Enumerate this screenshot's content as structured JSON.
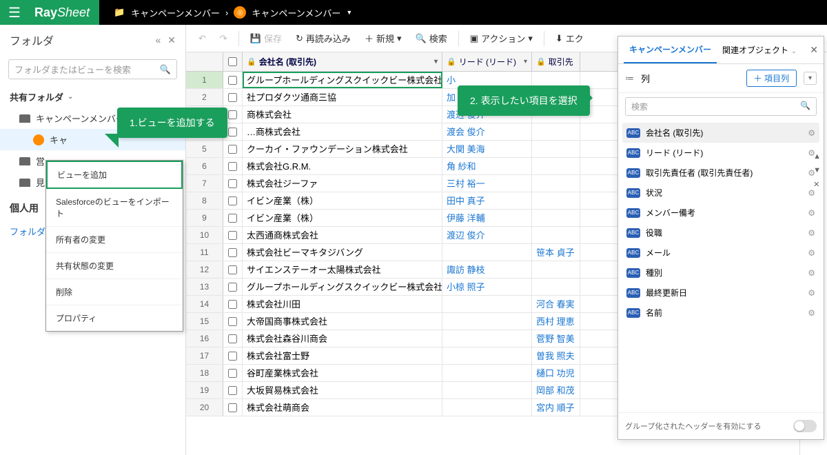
{
  "header": {
    "logo_ray": "Ray",
    "logo_sheet": "Sheet",
    "breadcrumb_parent": "キャンペーンメンバー",
    "breadcrumb_sep": "›",
    "breadcrumb_child": "キャンペーンメンバー",
    "breadcrumb_dd": "▼"
  },
  "sidebar": {
    "title": "フォルダ",
    "collapse": "«",
    "close": "✕",
    "search_placeholder": "フォルダまたはビューを検索",
    "shared_label": "共有フォルダ",
    "tree": {
      "campaign": "キャンペーンメンバー",
      "campaign_sub": "キャ",
      "sales": "営",
      "quote": "見"
    },
    "personal_label": "個人用",
    "folder_link": "フォルダを"
  },
  "ctx": {
    "add_view": "ビューを追加",
    "import_sf": "Salesforceのビューをインポート",
    "change_owner": "所有者の変更",
    "change_share": "共有状態の変更",
    "delete": "削除",
    "property": "プロパティ"
  },
  "callout": {
    "c1": "1.ビューを追加する",
    "c2": "2. 表示したい項目を選択"
  },
  "toolbar": {
    "undo": "↶",
    "redo": "↷",
    "save": "保存",
    "reload": "再読み込み",
    "new": "新規",
    "search": "検索",
    "action": "アクション",
    "export": "エク"
  },
  "grid": {
    "headers": {
      "company": "会社名 (取引先)",
      "lead": "リード (リード)",
      "owner": "取引先"
    },
    "rows": [
      {
        "n": 1,
        "company": "グループホールディングスクイックビー株式会社",
        "lead": "小",
        "owner": ""
      },
      {
        "n": 2,
        "company": "社プロダクツ通商三協",
        "lead": "加",
        "owner": ""
      },
      {
        "n": 3,
        "company": "商株式会社",
        "lead": "渡辺 俊介",
        "owner": ""
      },
      {
        "n": 4,
        "company": "…商株式会社",
        "lead": "渡会 俊介",
        "owner": ""
      },
      {
        "n": 5,
        "company": "クーカイ・ファウンデーション株式会社",
        "lead": "大関 美海",
        "owner": ""
      },
      {
        "n": 6,
        "company": "株式会社G.R.M.",
        "lead": "角 紗和",
        "owner": ""
      },
      {
        "n": 7,
        "company": "株式会社ジーファ",
        "lead": "三村 裕一",
        "owner": ""
      },
      {
        "n": 8,
        "company": "イビン産業（株）",
        "lead": "田中 真子",
        "owner": ""
      },
      {
        "n": 9,
        "company": "イビン産業（株）",
        "lead": "伊藤 洋輔",
        "owner": ""
      },
      {
        "n": 10,
        "company": "太西通商株式会社",
        "lead": "渡辺 俊介",
        "owner": ""
      },
      {
        "n": 11,
        "company": "株式会社ビーマキタジバング",
        "lead": "",
        "owner": "笹本 貞子"
      },
      {
        "n": 12,
        "company": "サイエンステーオー太陽株式会社",
        "lead": "諏訪 静枝",
        "owner": ""
      },
      {
        "n": 13,
        "company": "グループホールディングスクイックビー株式会社",
        "lead": "小椋 照子",
        "owner": ""
      },
      {
        "n": 14,
        "company": "株式会社川田",
        "lead": "",
        "owner": "河合 春実"
      },
      {
        "n": 15,
        "company": "大帝国商事株式会社",
        "lead": "",
        "owner": "西村 理恵"
      },
      {
        "n": 16,
        "company": "株式会社森谷川商会",
        "lead": "",
        "owner": "菅野 智美"
      },
      {
        "n": 17,
        "company": "株式会社富士野",
        "lead": "",
        "owner": "曽我 照夫"
      },
      {
        "n": 18,
        "company": "谷町産業株式会社",
        "lead": "",
        "owner": "樋口 功児"
      },
      {
        "n": 19,
        "company": "大坂貿易株式会社",
        "lead": "",
        "owner": "岡部 和茂"
      },
      {
        "n": 20,
        "company": "株式会社萌商会",
        "lead": "",
        "owner": "宮内 順子"
      }
    ]
  },
  "rpanel": {
    "tab_active": "キャンペーンメンバー",
    "tab_other": "関連オブジェクト",
    "section_label": "列",
    "add_col": "＋ 項目列",
    "search_placeholder": "検索",
    "items": [
      {
        "label": "会社名 (取引先)",
        "sel": true
      },
      {
        "label": "リード (リード)"
      },
      {
        "label": "取引先責任者 (取引先責任者)"
      },
      {
        "label": "状況"
      },
      {
        "label": "メンバー備考"
      },
      {
        "label": "役職"
      },
      {
        "label": "メール"
      },
      {
        "label": "種別"
      },
      {
        "label": "最終更新日"
      },
      {
        "label": "名前"
      }
    ],
    "footer": "グループ化されたヘッダーを有効にする"
  }
}
